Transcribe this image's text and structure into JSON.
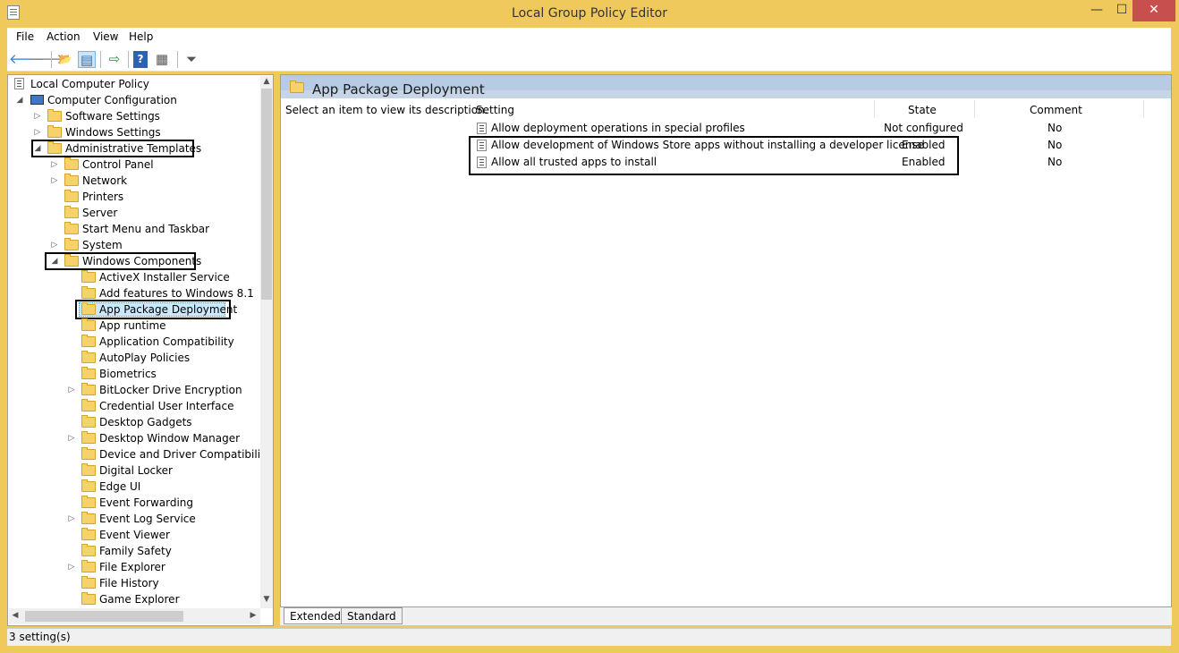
{
  "window": {
    "title": "Local Group Policy Editor",
    "min": "—",
    "max": "☐",
    "close": "✕"
  },
  "menu": {
    "file": "File",
    "action": "Action",
    "view": "View",
    "help": "Help"
  },
  "toolbar": {
    "back": "🡐",
    "forward": "🡒",
    "up": "📂",
    "show_hide_tree": "▤",
    "export": "⇨",
    "help": "?",
    "properties": "▦",
    "filter": "⏷"
  },
  "tree": {
    "nodes": [
      {
        "label": "Local Computer Policy",
        "arrow": ""
      },
      {
        "label": "Computer Configuration",
        "arrow": "◢"
      },
      {
        "label": "Software Settings",
        "arrow": "▷"
      },
      {
        "label": "Windows Settings",
        "arrow": "▷"
      },
      {
        "label": "Administrative Templates",
        "arrow": "◢"
      },
      {
        "label": "Control Panel",
        "arrow": "▷"
      },
      {
        "label": "Network",
        "arrow": "▷"
      },
      {
        "label": "Printers",
        "arrow": ""
      },
      {
        "label": "Server",
        "arrow": ""
      },
      {
        "label": "Start Menu and Taskbar",
        "arrow": ""
      },
      {
        "label": "System",
        "arrow": "▷"
      },
      {
        "label": "Windows Components",
        "arrow": "◢"
      },
      {
        "label": "ActiveX Installer Service",
        "arrow": ""
      },
      {
        "label": "Add features to Windows 8.1",
        "arrow": ""
      },
      {
        "label": "App Package Deployment",
        "arrow": ""
      },
      {
        "label": "App runtime",
        "arrow": ""
      },
      {
        "label": "Application Compatibility",
        "arrow": ""
      },
      {
        "label": "AutoPlay Policies",
        "arrow": ""
      },
      {
        "label": "Biometrics",
        "arrow": ""
      },
      {
        "label": "BitLocker Drive Encryption",
        "arrow": "▷"
      },
      {
        "label": "Credential User Interface",
        "arrow": ""
      },
      {
        "label": "Desktop Gadgets",
        "arrow": ""
      },
      {
        "label": "Desktop Window Manager",
        "arrow": "▷"
      },
      {
        "label": "Device and Driver Compatibility",
        "arrow": ""
      },
      {
        "label": "Digital Locker",
        "arrow": ""
      },
      {
        "label": "Edge UI",
        "arrow": ""
      },
      {
        "label": "Event Forwarding",
        "arrow": ""
      },
      {
        "label": "Event Log Service",
        "arrow": "▷"
      },
      {
        "label": "Event Viewer",
        "arrow": ""
      },
      {
        "label": "Family Safety",
        "arrow": ""
      },
      {
        "label": "File Explorer",
        "arrow": "▷"
      },
      {
        "label": "File History",
        "arrow": ""
      },
      {
        "label": "Game Explorer",
        "arrow": ""
      }
    ],
    "scroll_up": "▲",
    "scroll_down": "▼",
    "scroll_left": "◀",
    "scroll_right": "▶"
  },
  "right": {
    "title": "App Package Deployment",
    "description": "Select an item to view its description.",
    "columns": {
      "setting": "Setting",
      "state": "State",
      "comment": "Comment"
    },
    "rows": [
      {
        "setting": "Allow deployment operations in special profiles",
        "state": "Not configured",
        "comment": "No"
      },
      {
        "setting": "Allow development of Windows Store apps without installing a developer license",
        "state": "Enabled",
        "comment": "No"
      },
      {
        "setting": "Allow all trusted apps to install",
        "state": "Enabled",
        "comment": "No"
      }
    ]
  },
  "tabs": {
    "extended": "Extended",
    "standard": "Standard"
  },
  "status": {
    "text": "3 setting(s)"
  },
  "colors": {
    "frame": "#f0c95c",
    "close": "#c7504f",
    "header": "#c6d6e8",
    "selection": "#cce8ff"
  }
}
